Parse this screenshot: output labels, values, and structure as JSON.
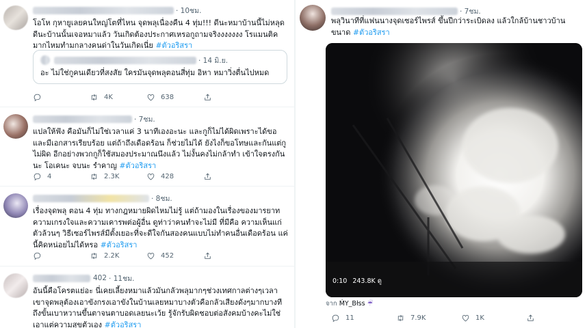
{
  "left": {
    "tweets": [
      {
        "time": "· 10ชม.",
        "text": "โอโห กุหายูเลยคนใหญ่โตที่ไหน จุดพลุเนื่องคืน 4 ทุ่ม!!! ดีนะหมาบ้านนี้ไม่หลุด ดีนะบ้านนั้นเจอหมาแล้ว วันเกิดต้องประกาศเหรอกูถามจริงงงงงงง โรแมนติคมากไหมทำมกลางคนด่าในวันเกิดเนี่ย ",
        "hashtag": "#ตัวอริสรา",
        "quote": {
          "time": "· 14 มิ.ย.",
          "text": "อะ ไม่ใช่กูคนเดียวที่สงสัย ใครมันจุดพลุตอนสี่ทุ่ม อิหา หมาวิ่งตื่นไปหมด"
        },
        "replies": "",
        "retweets": "4K",
        "likes": "638"
      },
      {
        "time": "· 7ชม.",
        "text": "แปลให้ฟัง คือมันก็ไม่ใช่เวลาแค่ 3 นาทีเองอะนะ และกูก็ไม่ได้ผิดเพราะได้ขอและมีเอกสารเรียบร้อย แต่ถ้าถึงเดือดร้อน ก็ช่วยไม่ได้ ยังไงก็ขอโทษและกันแต่กูไม่ผิด อีกอย่างพวกกูก็ใช้สมองประมาณนึงแล้ว ไม่งั้นคงไม่กล้าทำ เข้าใจตรงกันนะ โอเคนะ จบนะ รำคาญ ",
        "hashtag": "#ตัวอริสรา",
        "replies": "4",
        "retweets": "2.3K",
        "likes": "428"
      },
      {
        "time": "· 8ชม.",
        "text": "เรื่องจุดพลุ ตอน 4 ทุ่ม ทางกฎหมายผิดไหมไม่รู้ แต่ถ้ามองในเรื่องของมารยาท ความเกรงใจและความเคารพต่อผู้อื่น ดูท่าว่าคนทำจะไม่มี ที่มีคือ ความเห็นแก่ตัวล้วนๆ วิธีเซอร์ไพรส์มีตั้งเยอะที่จะดีใจกันสองคนแบบไม่ทำคนอื่นเดือดร้อน แค่นี้คิดหน่อยไม่ได้หรอ ",
        "hashtag": "#ตัวอริสรา",
        "replies": "",
        "retweets": "2.2K",
        "likes": "452"
      },
      {
        "handle": "402",
        "time": "· 11ชม.",
        "text": "อันนี้คือโครตแย่อะ นี่เคยเลี้ยงหมาแล้วมันกลัวพลุมากๆช่วงเทศกาลต่างๆเวลาเขาจุดพลุต้องเอาขังกรงเอาขังในบ้านเลยหมาบางตัวคือกลัวเสียงดังๆมากบางทีถึงขั้นเบาหวานขึ้นตาจนตาบอดเลยนะเว้ย รู้จักรับผิดชอบต่อสังคมบ้างคะไม่ใช่เอาแต่ความสุขตัวเอง ",
        "hashtag": "#ตัวอริสรา"
      }
    ]
  },
  "right": {
    "time": "· 7ชม.",
    "text": "พลุวินาทีที่แฟนนางจุดเซอร์ไพรส์ ขึ้นปีกว่าระเบิดลง แล้วใกล้บ้านชาวบ้านขนาด ",
    "hashtag": "#ตัวอริสรา",
    "video": {
      "duration": "0:10",
      "views": "243.8K ดู"
    },
    "credit_prefix": "จาก",
    "credit_name": "ḾY_Błss",
    "credit_emoji": "☔",
    "replies": "11",
    "retweets": "7.9K",
    "likes": "1K"
  },
  "colors": {
    "link": "#1d9bf0",
    "muted": "#536471",
    "border": "#eff3f4"
  }
}
